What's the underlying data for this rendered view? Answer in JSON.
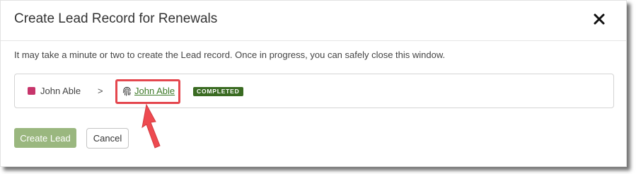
{
  "dialog": {
    "title": "Create Lead Record for Renewals",
    "close_icon": "close-icon"
  },
  "message": "It may take a minute or two to create the Lead record. Once in progress, you can safely close this window.",
  "record": {
    "source_name": "John Able",
    "source_color": "#c7356b",
    "separator": ">",
    "lead_icon": "fingerprint-icon",
    "lead_name": "John Able",
    "lead_link_color": "#3d7a28",
    "status": "COMPLETED",
    "status_color": "#3a6b22"
  },
  "actions": {
    "create_label": "Create Lead",
    "cancel_label": "Cancel"
  },
  "annotation": {
    "highlight_color": "#e4474e"
  }
}
